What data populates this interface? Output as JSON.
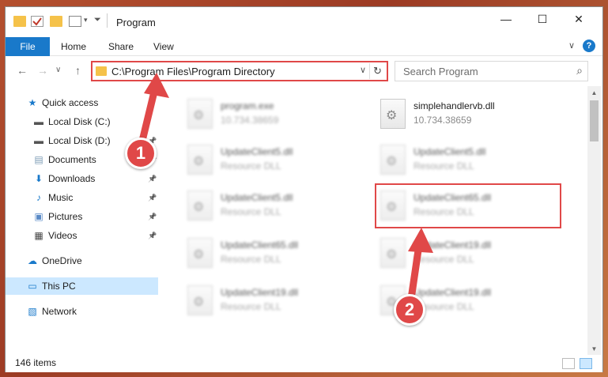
{
  "window": {
    "title": "Program",
    "controls": {
      "minimize": "—",
      "maximize": "☐",
      "close": "✕"
    }
  },
  "ribbon": {
    "tabs": [
      "File",
      "Home",
      "Share",
      "View"
    ],
    "expand_chevron": "∨",
    "help": "?"
  },
  "nav": {
    "back": "←",
    "forward": "→",
    "recent": "∨",
    "up": "↑",
    "address_path": "C:\\Program Files\\Program Directory",
    "address_dropdown": "∨",
    "refresh": "↻",
    "search_placeholder": "Search Program",
    "search_icon": "⌕"
  },
  "sidebar": {
    "items": [
      {
        "label": "Quick access",
        "icon": "star-icon",
        "glyph": "★",
        "color": "#1979ca",
        "pinned": false
      },
      {
        "label": "Local Disk (C:)",
        "icon": "drive-icon",
        "glyph": "▬",
        "color": "#555555",
        "pinned": false
      },
      {
        "label": "Local Disk (D:)",
        "icon": "drive-icon",
        "glyph": "▬",
        "color": "#555555",
        "pinned": true
      },
      {
        "label": "Documents",
        "icon": "documents-icon",
        "glyph": "▤",
        "color": "#7c9bb5",
        "pinned": true
      },
      {
        "label": "Downloads",
        "icon": "downloads-icon",
        "glyph": "⬇",
        "color": "#1979ca",
        "pinned": true
      },
      {
        "label": "Music",
        "icon": "music-icon",
        "glyph": "♪",
        "color": "#1979ca",
        "pinned": true
      },
      {
        "label": "Pictures",
        "icon": "pictures-icon",
        "glyph": "▣",
        "color": "#5a8ac6",
        "pinned": true
      },
      {
        "label": "Videos",
        "icon": "videos-icon",
        "glyph": "▦",
        "color": "#444444",
        "pinned": true
      },
      {
        "label": "OneDrive",
        "icon": "onedrive-icon",
        "glyph": "☁",
        "color": "#1979ca",
        "pinned": false
      },
      {
        "label": "This PC",
        "icon": "computer-icon",
        "glyph": "▭",
        "color": "#1979ca",
        "pinned": false,
        "selected": true
      },
      {
        "label": "Network",
        "icon": "network-icon",
        "glyph": "▧",
        "color": "#1979ca",
        "pinned": false
      }
    ],
    "pin_glyph": "📌"
  },
  "files": [
    {
      "name": "program.exe",
      "sub": "10.734.38659"
    },
    {
      "name": "UpdateClient5.dll",
      "sub": "Resource DLL"
    },
    {
      "name": "UpdateClient5.dll",
      "sub": "Resource DLL"
    },
    {
      "name": "UpdateClient65.dll",
      "sub": "Resource DLL"
    },
    {
      "name": "UpdateClient19.dll",
      "sub": "Resource DLL"
    },
    {
      "name": "simplehandlervb.dll",
      "sub": "10.734.38659"
    },
    {
      "name": "UpdateClient5.dll",
      "sub": "Resource DLL"
    },
    {
      "name": "UpdateClient65.dll",
      "sub": "Resource DLL"
    },
    {
      "name": "UpdateClient19.dll",
      "sub": "Resource DLL"
    },
    {
      "name": "UpdateClient19.dll",
      "sub": "Resource DLL"
    }
  ],
  "status": {
    "count": "146 items"
  },
  "annotations": {
    "step1": "1",
    "step2": "2",
    "color": "#e04848"
  }
}
